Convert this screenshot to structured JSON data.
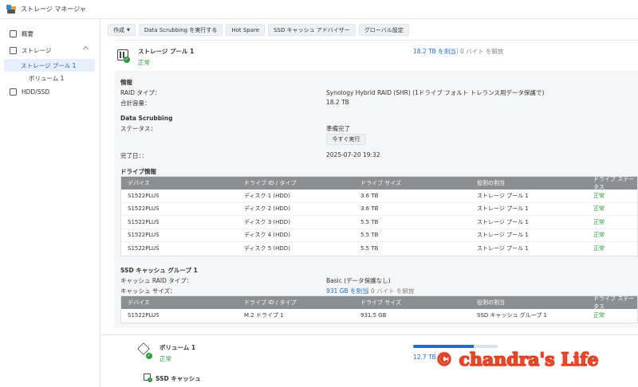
{
  "app": {
    "title": "ストレージ マネージャ"
  },
  "sidebar": {
    "items": [
      {
        "label": "概要",
        "icon": "overview-icon"
      },
      {
        "label": "ストレージ",
        "icon": "storage-icon"
      },
      {
        "label": "ストレージ プール 1"
      },
      {
        "label": "ボリューム 1"
      },
      {
        "label": "HDD/SSD",
        "icon": "hdd-icon"
      }
    ]
  },
  "toolbar": {
    "create": "作成",
    "scrub": "Data Scrubbing を実行する",
    "hotspare": "Hot Spare",
    "ssd_advisor": "SSD キャッシュ アドバイザー",
    "global": "グローバル設定"
  },
  "pool": {
    "name": "ストレージ プール 1",
    "status": "正常",
    "allocated": "18.2 TB を割当",
    "separator": "|",
    "free": "0 バイト を解放",
    "info_header": "情報",
    "raid_label": "RAID タイプ：",
    "raid_value": "Synology Hybrid RAID (SHR) (1ドライブ フォルト トレランス用データ保護で)",
    "capacity_label": "合計容量：",
    "capacity_value": "18.2 TB",
    "scrub_header": "Data Scrubbing",
    "scrub_status_label": "ステータス：",
    "scrub_status_value": "準備完了",
    "run_now": "今すぐ実行",
    "completed_label": "完了日：：",
    "completed_value": "2025-07-20 19:32"
  },
  "drive_info": {
    "header": "ドライブ情報",
    "columns": [
      "デバイス",
      "ドライブ ID / タイプ",
      "ドライブ サイズ",
      "役割の割当",
      "ドライブ ステータス"
    ],
    "rows": [
      [
        "S1522PLUS",
        "ディスク 1 (HDD)",
        "3.6 TB",
        "ストレージ プール 1",
        "正常"
      ],
      [
        "S1522PLUS",
        "ディスク 2 (HDD)",
        "3.6 TB",
        "ストレージ プール 1",
        "正常"
      ],
      [
        "S1522PLUS",
        "ディスク 3 (HDD)",
        "5.5 TB",
        "ストレージ プール 1",
        "正常"
      ],
      [
        "S1522PLUS",
        "ディスク 4 (HDD)",
        "5.5 TB",
        "ストレージ プール 1",
        "正常"
      ],
      [
        "S1522PLUS",
        "ディスク 5 (HDD)",
        "5.5 TB",
        "ストレージ プール 1",
        "正常"
      ]
    ]
  },
  "ssd_cache": {
    "header": "SSD キャッシュ グループ 1",
    "raid_label": "キャッシュ RAID タイプ：",
    "raid_value": "Basic (データ保護なし)",
    "size_label": "キャッシュ サイズ：",
    "size_allocated": "931 GB を割当",
    "separator": "|",
    "size_free": "0 バイト を解放",
    "columns": [
      "デバイス",
      "ドライブ ID / タイプ",
      "ドライブ サイズ",
      "役割の割当",
      "ドライブ ステータス"
    ],
    "rows": [
      [
        "S1522PLUS",
        "M.2 ドライブ 1",
        "931.5 GB",
        "SSD キャッシュ グループ 1",
        "正常"
      ]
    ]
  },
  "volume": {
    "name": "ボリューム 1",
    "status": "正常",
    "usage_text": "12.7 TB",
    "usage_fraction": 0.72,
    "ssd_cache_label": "SSD キャッシュ"
  },
  "watermark": "© chandra's Life",
  "colors": {
    "ok": "#2a9d3b",
    "link": "#1a6fd1",
    "table_header": "#8a8f94"
  }
}
